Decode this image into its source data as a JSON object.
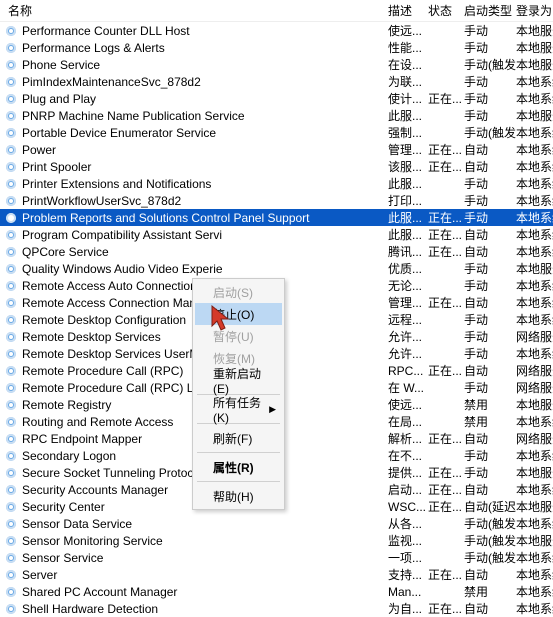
{
  "header": {
    "name": "名称",
    "desc": "描述",
    "status": "状态",
    "start": "启动类型",
    "logon": "登录为"
  },
  "rows": [
    {
      "name": "Performance Counter DLL Host",
      "desc": "使远...",
      "status": "",
      "start": "手动",
      "logon": "本地服务"
    },
    {
      "name": "Performance Logs & Alerts",
      "desc": "性能...",
      "status": "",
      "start": "手动",
      "logon": "本地服务"
    },
    {
      "name": "Phone Service",
      "desc": "在设...",
      "status": "",
      "start": "手动(触发...",
      "logon": "本地服务"
    },
    {
      "name": "PimIndexMaintenanceSvc_878d2",
      "desc": "为联...",
      "status": "",
      "start": "手动",
      "logon": "本地系统"
    },
    {
      "name": "Plug and Play",
      "desc": "使计...",
      "status": "正在...",
      "start": "手动",
      "logon": "本地系统"
    },
    {
      "name": "PNRP Machine Name Publication Service",
      "desc": "此服...",
      "status": "",
      "start": "手动",
      "logon": "本地服务"
    },
    {
      "name": "Portable Device Enumerator Service",
      "desc": "强制...",
      "status": "",
      "start": "手动(触发...",
      "logon": "本地系统"
    },
    {
      "name": "Power",
      "desc": "管理...",
      "status": "正在...",
      "start": "自动",
      "logon": "本地系统"
    },
    {
      "name": "Print Spooler",
      "desc": "该服...",
      "status": "正在...",
      "start": "自动",
      "logon": "本地系统"
    },
    {
      "name": "Printer Extensions and Notifications",
      "desc": "此服...",
      "status": "",
      "start": "手动",
      "logon": "本地系统"
    },
    {
      "name": "PrintWorkflowUserSvc_878d2",
      "desc": "打印...",
      "status": "",
      "start": "手动",
      "logon": "本地系统"
    },
    {
      "name": "Problem Reports and Solutions Control Panel Support",
      "desc": "此服...",
      "status": "正在...",
      "start": "手动",
      "logon": "本地系统",
      "selected": true
    },
    {
      "name": "Program Compatibility Assistant Servi",
      "desc": "此服...",
      "status": "正在...",
      "start": "自动",
      "logon": "本地系统"
    },
    {
      "name": "QPCore Service",
      "desc": "腾讯...",
      "status": "正在...",
      "start": "自动",
      "logon": "本地系统"
    },
    {
      "name": "Quality Windows Audio Video Experie",
      "desc": "优质...",
      "status": "",
      "start": "手动",
      "logon": "本地服务"
    },
    {
      "name": "Remote Access Auto Connection Mar",
      "desc": "无论...",
      "status": "",
      "start": "手动",
      "logon": "本地系统"
    },
    {
      "name": "Remote Access Connection Manager",
      "desc": "管理...",
      "status": "正在...",
      "start": "自动",
      "logon": "本地系统"
    },
    {
      "name": "Remote Desktop Configuration",
      "desc": "远程...",
      "status": "",
      "start": "手动",
      "logon": "本地系统"
    },
    {
      "name": "Remote Desktop Services",
      "desc": "允许...",
      "status": "",
      "start": "手动",
      "logon": "网络服务"
    },
    {
      "name": "Remote Desktop Services UserMode F",
      "desc": "允许...",
      "status": "",
      "start": "手动",
      "logon": "本地系统"
    },
    {
      "name": "Remote Procedure Call (RPC)",
      "desc": "RPC...",
      "status": "正在...",
      "start": "自动",
      "logon": "网络服务"
    },
    {
      "name": "Remote Procedure Call (RPC) Locator",
      "desc": "在 W...",
      "status": "",
      "start": "手动",
      "logon": "网络服务"
    },
    {
      "name": "Remote Registry",
      "desc": "使远...",
      "status": "",
      "start": "禁用",
      "logon": "本地服务"
    },
    {
      "name": "Routing and Remote Access",
      "desc": "在局...",
      "status": "",
      "start": "禁用",
      "logon": "本地系统"
    },
    {
      "name": "RPC Endpoint Mapper",
      "desc": "解析...",
      "status": "正在...",
      "start": "自动",
      "logon": "网络服务"
    },
    {
      "name": "Secondary Logon",
      "desc": "在不...",
      "status": "",
      "start": "手动",
      "logon": "本地系统"
    },
    {
      "name": "Secure Socket Tunneling Protocol Service",
      "desc": "提供...",
      "status": "正在...",
      "start": "手动",
      "logon": "本地服务"
    },
    {
      "name": "Security Accounts Manager",
      "desc": "启动...",
      "status": "正在...",
      "start": "自动",
      "logon": "本地系统"
    },
    {
      "name": "Security Center",
      "desc": "WSC...",
      "status": "正在...",
      "start": "自动(延迟...",
      "logon": "本地服务"
    },
    {
      "name": "Sensor Data Service",
      "desc": "从各...",
      "status": "",
      "start": "手动(触发...",
      "logon": "本地系统"
    },
    {
      "name": "Sensor Monitoring Service",
      "desc": "监视...",
      "status": "",
      "start": "手动(触发...",
      "logon": "本地服务"
    },
    {
      "name": "Sensor Service",
      "desc": "一项...",
      "status": "",
      "start": "手动(触发...",
      "logon": "本地系统"
    },
    {
      "name": "Server",
      "desc": "支持...",
      "status": "正在...",
      "start": "自动",
      "logon": "本地系统"
    },
    {
      "name": "Shared PC Account Manager",
      "desc": "Man...",
      "status": "",
      "start": "禁用",
      "logon": "本地系统"
    },
    {
      "name": "Shell Hardware Detection",
      "desc": "为自...",
      "status": "正在...",
      "start": "自动",
      "logon": "本地系统"
    }
  ],
  "context_menu": {
    "start": "启动(S)",
    "stop": "停止(O)",
    "pause": "暂停(U)",
    "resume": "恢复(M)",
    "restart": "重新启动(E)",
    "all_tasks": "所有任务(K)",
    "refresh": "刷新(F)",
    "properties": "属性(R)",
    "help": "帮助(H)"
  }
}
